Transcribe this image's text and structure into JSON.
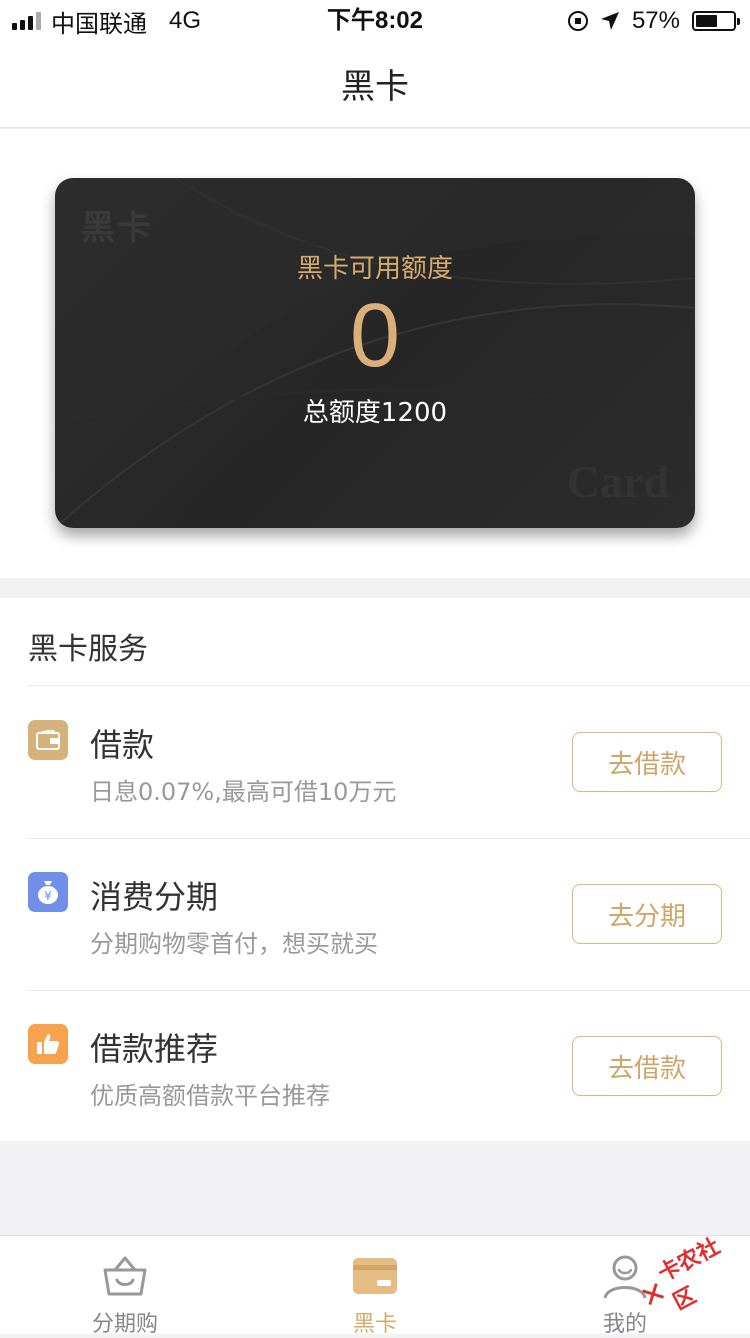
{
  "status_bar": {
    "carrier": "中国联通",
    "network": "4G",
    "time": "下午8:02",
    "battery": "57%",
    "battery_level": 0.57
  },
  "nav": {
    "title": "黑卡"
  },
  "card": {
    "corner_logo": "黑卡",
    "label": "黑卡可用额度",
    "available": "0",
    "total": "总额度1200",
    "watermark": "Card",
    "accent_color": "#d9b07a"
  },
  "services": {
    "title": "黑卡服务",
    "items": [
      {
        "title": "借款",
        "desc": "日息0.07%,最高可借10万元",
        "button": "去借款",
        "icon": "wallet-icon",
        "icon_color": "#d4b27a"
      },
      {
        "title": "消费分期",
        "desc": "分期购物零首付，想买就买",
        "button": "去分期",
        "icon": "money-bag-icon",
        "icon_color": "#6f8fe8"
      },
      {
        "title": "借款推荐",
        "desc": "优质高额借款平台推荐",
        "button": "去借款",
        "icon": "thumbs-up-icon",
        "icon_color": "#f7a24c"
      }
    ]
  },
  "tabs": [
    {
      "label": "分期购",
      "icon": "basket-icon",
      "active": false
    },
    {
      "label": "黑卡",
      "icon": "card-icon",
      "active": true
    },
    {
      "label": "我的",
      "icon": "person-icon",
      "active": false
    }
  ],
  "watermark_stamp": "卡农社区"
}
